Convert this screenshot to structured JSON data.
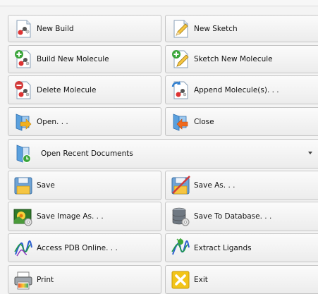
{
  "buttons": {
    "new_build": "New Build",
    "new_sketch": "New Sketch",
    "build_new_molecule": "Build New Molecule",
    "sketch_new_molecule": "Sketch New Molecule",
    "delete_molecule": "Delete Molecule",
    "append_molecules": "Append Molecule(s). . .",
    "open": "Open. . .",
    "close": "Close",
    "open_recent": "Open Recent Documents",
    "save": "Save",
    "save_as": "Save As. . .",
    "save_image_as": "Save Image As. . .",
    "save_to_database": "Save To Database. . .",
    "access_pdb_online": "Access PDB Online. . .",
    "extract_ligands": "Extract Ligands",
    "print": "Print",
    "exit": "Exit"
  },
  "icons": {
    "new_build": "molecule-page-icon",
    "new_sketch": "pencil-page-icon",
    "build_new_molecule": "add-molecule-icon",
    "sketch_new_molecule": "add-sketch-icon",
    "delete_molecule": "delete-molecule-icon",
    "append_molecules": "append-molecule-icon",
    "open": "open-folder-icon",
    "close": "close-folder-icon",
    "open_recent": "recent-documents-icon",
    "save": "save-icon",
    "save_as": "save-as-icon",
    "save_image_as": "save-image-icon",
    "save_to_database": "database-icon",
    "access_pdb_online": "protein-icon",
    "extract_ligands": "extract-ligands-icon",
    "print": "printer-icon",
    "exit": "exit-icon"
  },
  "colors": {
    "background": "#f4f4f4",
    "button_top": "#fbfbfb",
    "button_bottom": "#ececec",
    "button_border": "#c4c4c4",
    "add_green": "#3aa53a",
    "delete_red": "#d23a3a",
    "folder_blue": "#5aa0de",
    "exit_yellow": "#f2c418"
  }
}
